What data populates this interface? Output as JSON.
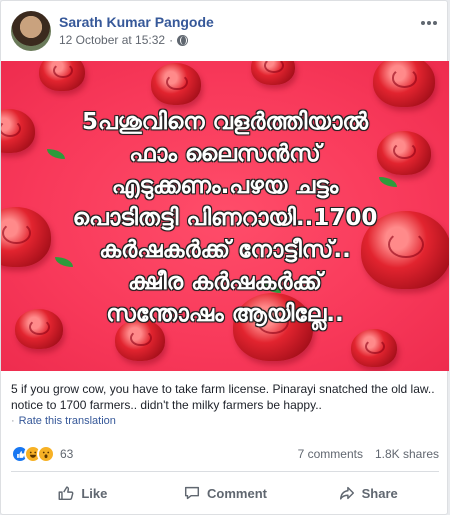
{
  "post": {
    "author": "Sarath Kumar Pangode",
    "timestamp": "12 October at 15:32",
    "privacy_dot": "·",
    "image_text": "5പശുവിനെ വളർത്തിയാൽ\nഫാം ലൈസൻസ്\nഎടുക്കണം.പഴയ ചട്ടം\nപൊടിതട്ടി പിണറായി..1700\nകർഷകർക്ക് നോട്ടീസ്..\nക്ഷീര കർഷകർക്ക്\nസന്തോഷം ആയില്ലേ..",
    "translation": "5 if you grow cow, you have to take farm license. Pinarayi snatched the old law.. notice to 1700 farmers.. didn't the milky farmers be happy..",
    "rate_dot": "·",
    "rate_label": "Rate this translation"
  },
  "stats": {
    "reaction_count": "63",
    "comments": "7 comments",
    "shares": "1.8K shares"
  },
  "actions": {
    "like": "Like",
    "comment": "Comment",
    "share": "Share"
  },
  "icons": {
    "privacy": "globe-icon",
    "more": "more-options-icon",
    "like": "thumbs-up-icon",
    "comment": "comment-bubble-icon",
    "share": "share-arrow-icon",
    "reactions": [
      "like-reaction-icon",
      "haha-reaction-icon",
      "wow-reaction-icon"
    ]
  },
  "colors": {
    "link": "#365899",
    "image_background": "#f8395a",
    "rose": "#e2242f",
    "like_blue": "#1877f2",
    "emoji_yellow": "#f7b125"
  }
}
